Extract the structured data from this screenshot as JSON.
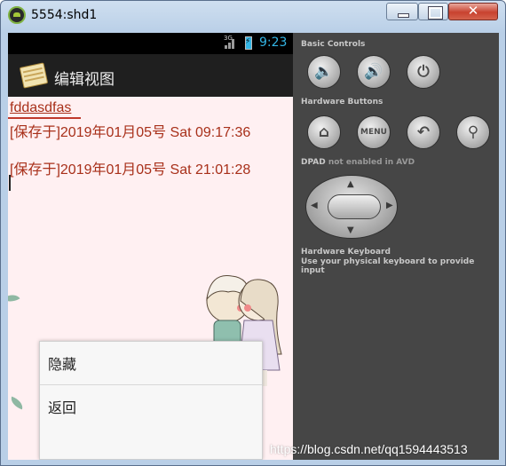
{
  "window": {
    "title": "5554:shd1"
  },
  "statusbar": {
    "network": "3G",
    "clock": "9:23"
  },
  "actionbar": {
    "title": "编辑视图"
  },
  "content": {
    "link_text": "fddasdfas",
    "notes": [
      "[保存于]2019年01月05号 Sat 09:17:36",
      "[保存于]2019年01月05号 Sat 21:01:28"
    ]
  },
  "popup_menu": {
    "items": [
      "隐藏",
      "返回"
    ]
  },
  "controls": {
    "basic_label": "Basic Controls",
    "hardware_label": "Hardware Buttons",
    "menu_label": "MENU",
    "dpad_label": "DPAD",
    "dpad_note": "not enabled in AVD",
    "keyboard_label": "Hardware Keyboard",
    "keyboard_hint": "Use your physical keyboard to provide input"
  },
  "watermark": "https://blog.csdn.net/qq1594443513",
  "colors": {
    "note_text": "#a8301a",
    "clock": "#33b5e5",
    "content_bg": "#fff0f2",
    "panel_bg": "#464646"
  }
}
